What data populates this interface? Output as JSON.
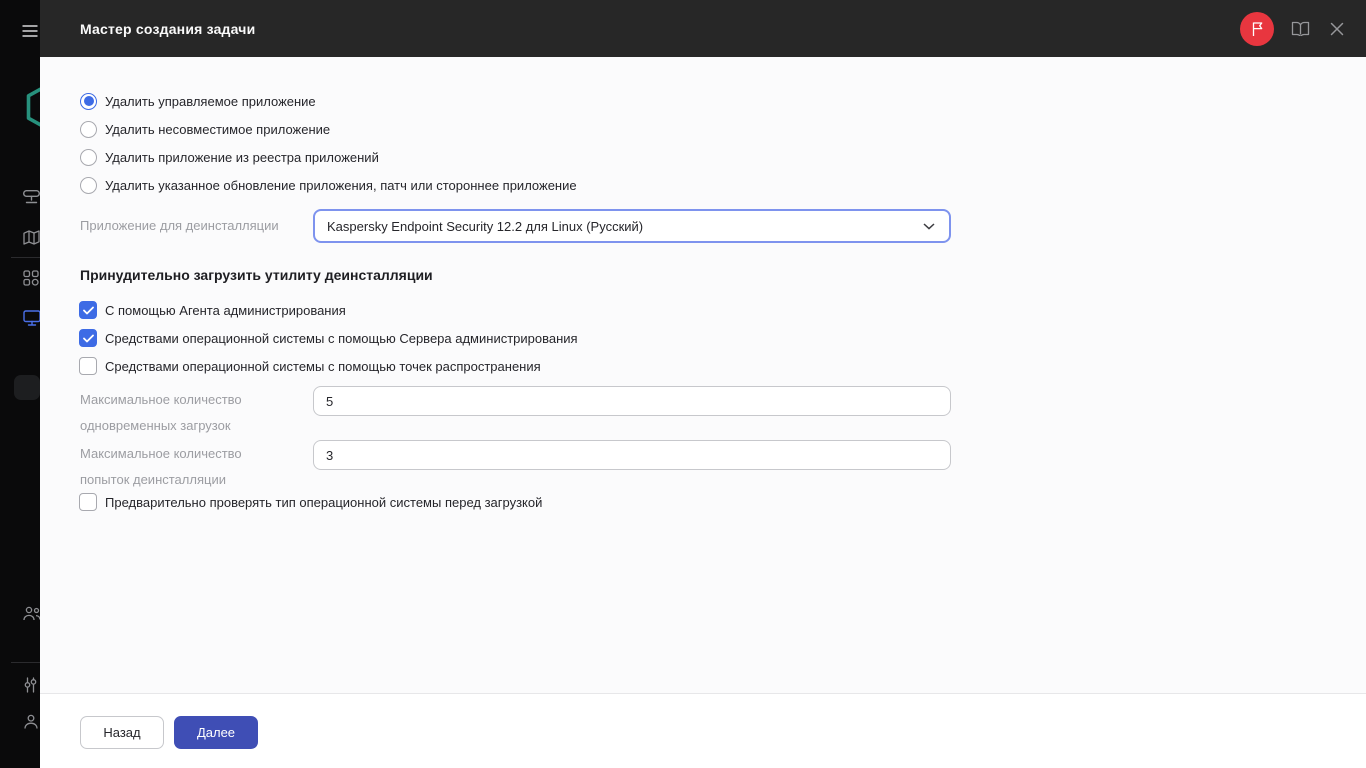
{
  "colors": {
    "accent_blue": "#3D6BE5",
    "primary_button": "#3F4EB5",
    "badge_red": "#E8363F",
    "header_bg": "#272727",
    "sidebar_bg": "#0A0A0B",
    "logo_teal": "#27917D",
    "active_nav_blue": "#4A6FE8"
  },
  "sidebar": {
    "icons": [
      "menu-icon",
      "kaspersky-logo",
      "monitoring-icon",
      "map-icon",
      "apps-grid-icon",
      "devices-icon",
      "users-icon",
      "sliders-icon",
      "user-icon"
    ]
  },
  "header": {
    "title": "Мастер создания задачи",
    "icons": [
      "flag-icon",
      "book-icon",
      "close-icon"
    ]
  },
  "wizard": {
    "uninstall_options": [
      {
        "label": "Удалить управляемое приложение",
        "selected": true
      },
      {
        "label": "Удалить несовместимое приложение",
        "selected": false
      },
      {
        "label": "Удалить приложение из реестра приложений",
        "selected": false
      },
      {
        "label": "Удалить указанное обновление приложения, патч или стороннее приложение",
        "selected": false
      }
    ],
    "app_select": {
      "label": "Приложение для деинсталляции",
      "value": "Kaspersky Endpoint Security 12.2 для Linux (Русский)"
    },
    "force_section": {
      "title": "Принудительно загрузить утилиту деинсталляции",
      "checkboxes": [
        {
          "label": "С помощью Агента администрирования",
          "checked": true
        },
        {
          "label": "Средствами операционной системы с помощью Сервера администрирования",
          "checked": true
        },
        {
          "label": "Средствами операционной системы с помощью точек распространения",
          "checked": false
        }
      ]
    },
    "fields": [
      {
        "label": "Максимальное количество одновременных загрузок",
        "value": "5"
      },
      {
        "label": "Максимальное количество попыток деинсталляции",
        "value": "3"
      }
    ],
    "os_type_checkbox": {
      "label": "Предварительно проверять тип операционной системы перед загрузкой",
      "checked": false
    }
  },
  "footer": {
    "back_label": "Назад",
    "next_label": "Далее"
  }
}
